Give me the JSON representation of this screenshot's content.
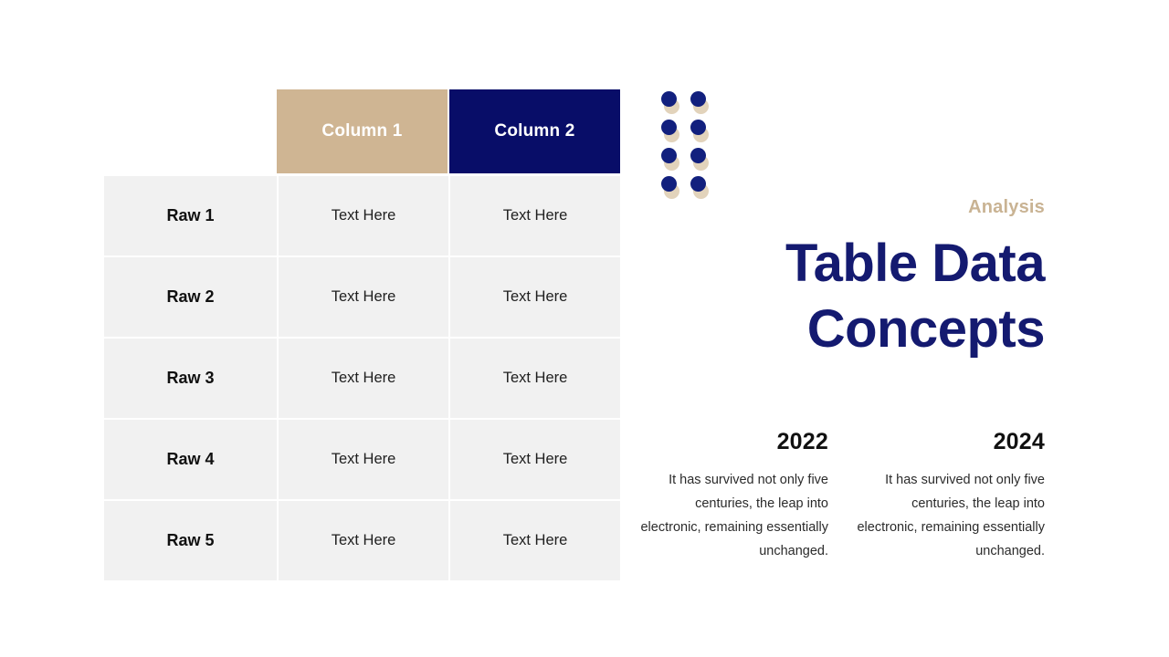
{
  "colors": {
    "navy": "#080d68",
    "tan": "#cfb593",
    "title_navy": "#141a70",
    "eyebrow_tan": "#c9b393",
    "cell_gray": "#f1f1f1",
    "dot_navy": "#12207e",
    "dot_tan": "#e2d3bb"
  },
  "table": {
    "headers": [
      "",
      "Column 1",
      "Column 2"
    ],
    "rows": [
      {
        "label": "Raw 1",
        "col1": "Text Here",
        "col2": "Text Here"
      },
      {
        "label": "Raw 2",
        "col1": "Text Here",
        "col2": "Text Here"
      },
      {
        "label": "Raw 3",
        "col1": "Text Here",
        "col2": "Text Here"
      },
      {
        "label": "Raw 4",
        "col1": "Text Here",
        "col2": "Text Here"
      },
      {
        "label": "Raw 5",
        "col1": "Text Here",
        "col2": "Text Here"
      }
    ]
  },
  "decoration": {
    "dot_grid": {
      "rows": 4,
      "cols": 2,
      "col_gap": 32,
      "row_gap": 31
    }
  },
  "right_panel": {
    "eyebrow": "Analysis",
    "title": "Table Data Concepts"
  },
  "year_columns": [
    {
      "year": "2022",
      "body": "It has survived not only five centuries, the leap into electronic, remaining essentially unchanged."
    },
    {
      "year": "2024",
      "body": "It has survived not only five centuries, the leap into electronic, remaining essentially unchanged."
    }
  ]
}
